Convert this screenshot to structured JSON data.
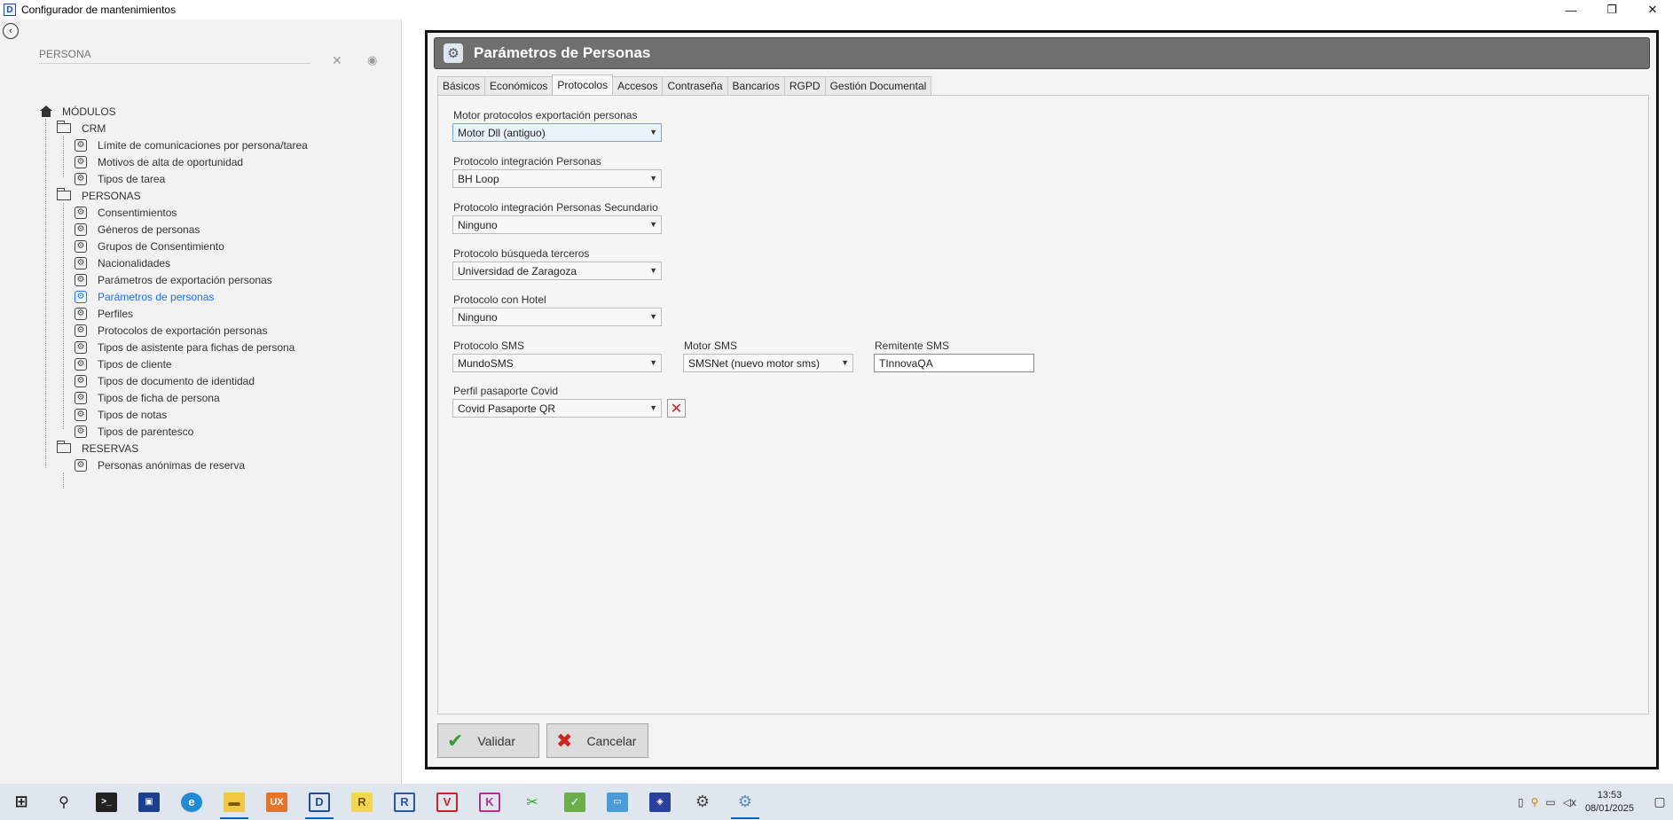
{
  "window": {
    "title": "Configurador de mantenimientos",
    "app_icon": "D",
    "controls": {
      "minimize": "—",
      "restore": "❐",
      "close": "✕"
    }
  },
  "sidebar": {
    "search_value": "PERSONA",
    "tree_root": "MÓDULOS",
    "groups": [
      {
        "label": "CRM",
        "items": [
          "Límite de comunicaciones por persona/tarea",
          "Motivos de alta de oportunidad",
          "Tipos de tarea"
        ]
      },
      {
        "label": "PERSONAS",
        "items": [
          "Consentimientos",
          "Géneros de personas",
          "Grupos de Consentimiento",
          "Nacionalidades",
          "Parámetros de exportación personas",
          "Parámetros de personas",
          "Perfiles",
          "Protocolos de exportación personas",
          "Tipos de asistente para fichas de persona",
          "Tipos de cliente",
          "Tipos de documento de identidad",
          "Tipos de ficha de persona",
          "Tipos de notas",
          "Tipos de parentesco"
        ]
      },
      {
        "label": "RESERVAS",
        "items": [
          "Personas anónimas de reserva"
        ]
      }
    ],
    "active_item": "Parámetros de personas"
  },
  "main": {
    "title": "Parámetros de Personas",
    "tabs": [
      "Básicos",
      "Económicos",
      "Protocolos",
      "Accesos",
      "Contraseña",
      "Bancarios",
      "RGPD",
      "Gestión Documental"
    ],
    "active_tab": "Protocolos",
    "fields": {
      "motor_export": {
        "label": "Motor protocolos exportación personas",
        "value": "Motor Dll (antiguo)"
      },
      "integracion": {
        "label": "Protocolo integración Personas",
        "value": "BH Loop"
      },
      "integracion_sec": {
        "label": "Protocolo integración Personas Secundario",
        "value": "Ninguno"
      },
      "busqueda": {
        "label": "Protocolo búsqueda terceros",
        "value": "Universidad de Zaragoza"
      },
      "hotel": {
        "label": "Protocolo con Hotel",
        "value": "Ninguno"
      },
      "sms": {
        "label": "Protocolo SMS",
        "value": "MundoSMS"
      },
      "motor_sms": {
        "label": "Motor SMS",
        "value": "SMSNet (nuevo motor sms)"
      },
      "remitente": {
        "label": "Remitente SMS",
        "value": "TInnovaQA"
      },
      "covid": {
        "label": "Perfil pasaporte Covid",
        "value": "Covid Pasaporte QR"
      }
    },
    "buttons": {
      "ok": "Validar",
      "cancel": "Cancelar"
    }
  },
  "taskbar": {
    "time": "13:53",
    "date": "08/01/2025"
  }
}
